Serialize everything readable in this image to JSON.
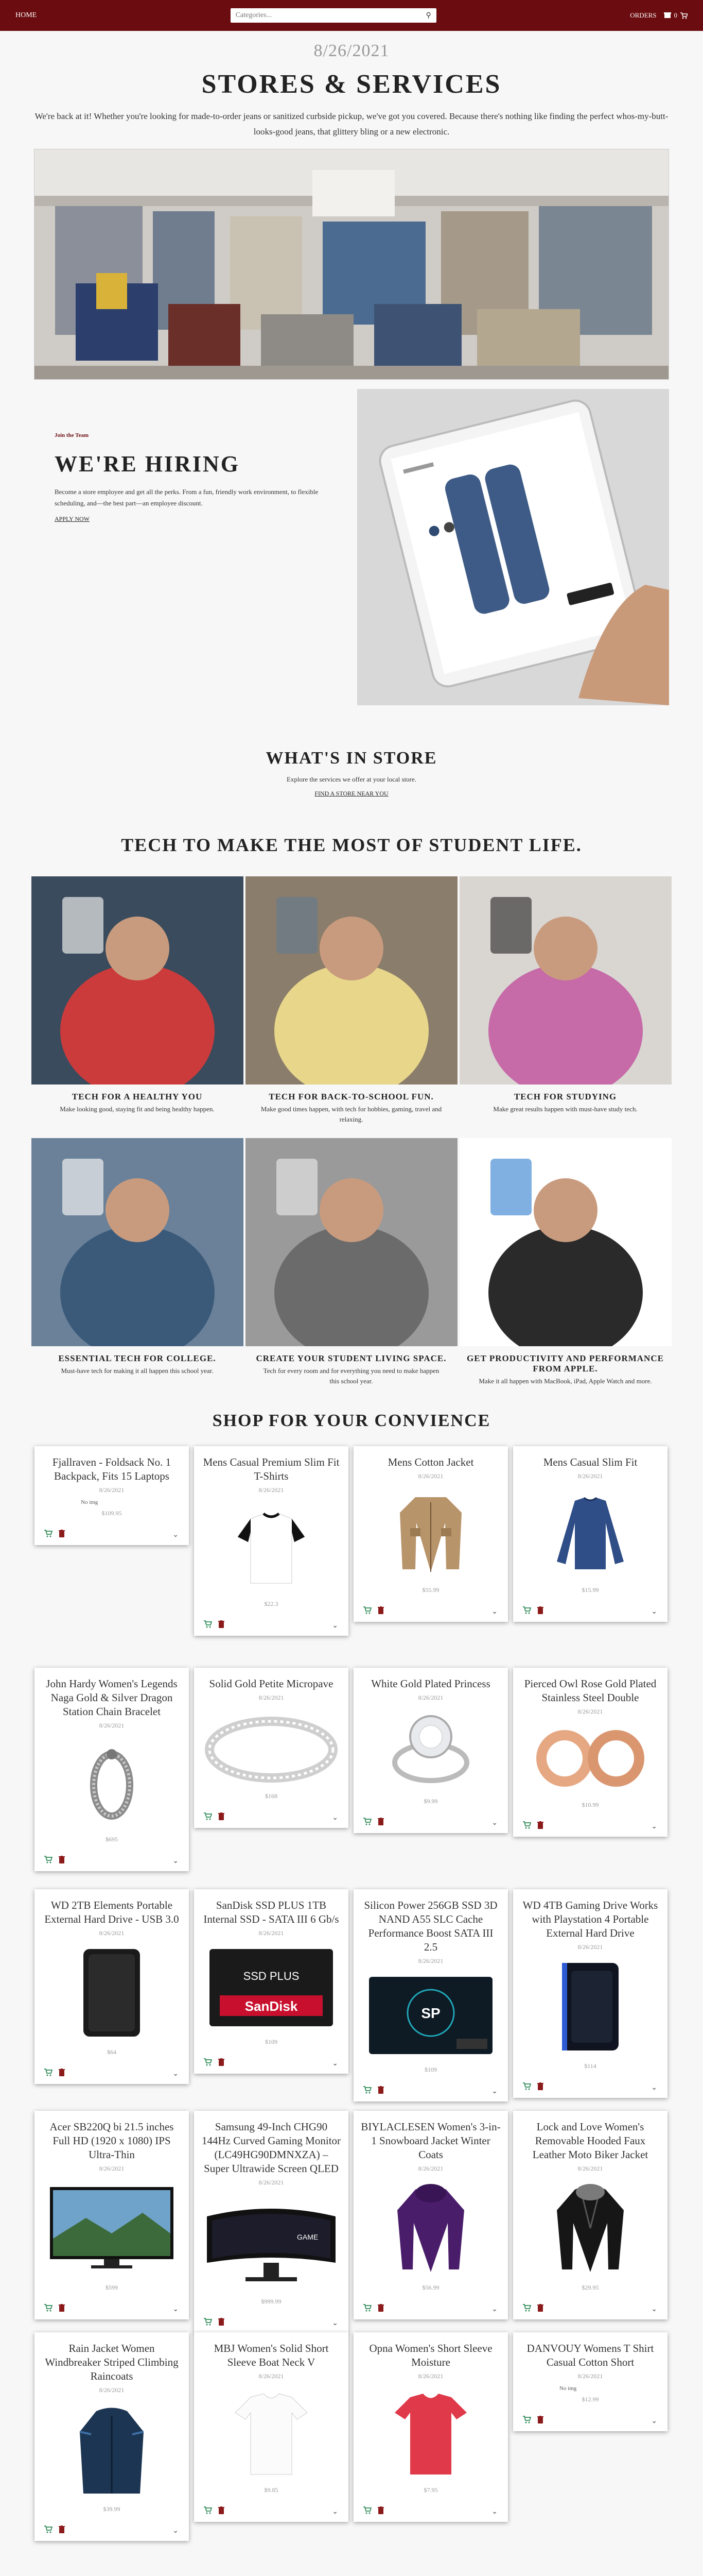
{
  "nav": {
    "home": "HOME",
    "search_placeholder": "Categories...",
    "orders": "ORDERS",
    "cart_count": "0"
  },
  "page": {
    "date": "8/26/2021",
    "title": "STORES & SERVICES",
    "intro": "We're back at it! Whether you're looking for made-to-order jeans or sanitized curbside pickup, we've got you covered. Because there's nothing like finding the perfect whos-my-butt-looks-good jeans, that glittery bling or a new electronic."
  },
  "hiring": {
    "kicker": "Join the Team",
    "title": "WE'RE HIRING",
    "body": "Become a store employee and get all the perks. From a fun, friendly work environment, to flexible scheduling, and—the best part—an employee discount.",
    "link": "APPLY NOW"
  },
  "instore": {
    "title": "WHAT'S IN STORE",
    "body": "Explore the services we offer at your local store.",
    "link": "FIND A STORE NEAR YOU"
  },
  "tech": {
    "title": "TECH TO MAKE THE MOST OF STUDENT LIFE.",
    "cards": [
      {
        "title": "TECH FOR A HEALTHY YOU",
        "body": "Make looking good, staying fit and being healthy happen."
      },
      {
        "title": "TECH FOR BACK-TO-SCHOOL FUN.",
        "body": "Make good times happen, with tech for hobbies, gaming, travel and relaxing."
      },
      {
        "title": "TECH FOR STUDYING",
        "body": "Make great results happen with must-have study tech."
      },
      {
        "title": "ESSENTIAL TECH FOR COLLEGE.",
        "body": "Must-have tech for making it all happen this school year."
      },
      {
        "title": "CREATE YOUR STUDENT LIVING SPACE.",
        "body": "Tech for every room and for everything you need to make happen this school year."
      },
      {
        "title": "GET PRODUCTIVITY AND PERFORMANCE FROM APPLE.",
        "body": "Make it all happen with MacBook, iPad, Apple Watch and more."
      }
    ]
  },
  "shop": {
    "title": "SHOP FOR YOUR CONVIENCE",
    "products": [
      {
        "title": "Fjallraven - Foldsack No. 1 Backpack, Fits 15 Laptops",
        "date": "8/26/2021",
        "price": "$109.95",
        "img": "broken",
        "alt": "No img"
      },
      {
        "title": "Mens Casual Premium Slim Fit T-Shirts",
        "date": "8/26/2021",
        "price": "$22.3",
        "img": "tshirt"
      },
      {
        "title": "Mens Cotton Jacket",
        "date": "8/26/2021",
        "price": "$55.99",
        "img": "jacket"
      },
      {
        "title": "Mens Casual Slim Fit",
        "date": "8/26/2021",
        "price": "$15.99",
        "img": "longsleeve"
      },
      {
        "title": "John Hardy Women's Legends Naga Gold & Silver Dragon Station Chain Bracelet",
        "date": "8/26/2021",
        "price": "$695",
        "img": "bracelet"
      },
      {
        "title": "Solid Gold Petite Micropave",
        "date": "8/26/2021",
        "price": "$168",
        "img": "ring"
      },
      {
        "title": "White Gold Plated Princess",
        "date": "8/26/2021",
        "price": "$9.99",
        "img": "princess"
      },
      {
        "title": "Pierced Owl Rose Gold Plated Stainless Steel Double",
        "date": "8/26/2021",
        "price": "$10.99",
        "img": "rings"
      },
      {
        "title": "WD 2TB Elements Portable External Hard Drive - USB 3.0",
        "date": "8/26/2021",
        "price": "$64",
        "img": "wd"
      },
      {
        "title": "SanDisk SSD PLUS 1TB Internal SSD - SATA III 6 Gb/s",
        "date": "8/26/2021",
        "price": "$109",
        "img": "sandisk"
      },
      {
        "title": "Silicon Power 256GB SSD 3D NAND A55 SLC Cache Performance Boost SATA III 2.5",
        "date": "8/26/2021",
        "price": "$109",
        "img": "sp"
      },
      {
        "title": "WD 4TB Gaming Drive Works with Playstation 4 Portable External Hard Drive",
        "date": "8/26/2021",
        "price": "$114",
        "img": "wd4"
      },
      {
        "title": "Acer SB220Q bi 21.5 inches Full HD (1920 x 1080) IPS Ultra-Thin",
        "date": "8/26/2021",
        "price": "$599",
        "img": "monitor"
      },
      {
        "title": "Samsung 49-Inch CHG90 144Hz Curved Gaming Monitor (LC49HG90DMNXZA) – Super Ultrawide Screen QLED",
        "date": "8/26/2021",
        "price": "$999.99",
        "img": "curved"
      },
      {
        "title": "BIYLACLESEN Women's 3-in-1 Snowboard Jacket Winter Coats",
        "date": "8/26/2021",
        "price": "$56.99",
        "img": "purplejacket"
      },
      {
        "title": "Lock and Love Women's Removable Hooded Faux Leather Moto Biker Jacket",
        "date": "8/26/2021",
        "price": "$29.95",
        "img": "leather"
      },
      {
        "title": "Rain Jacket Women Windbreaker Striped Climbing Raincoats",
        "date": "8/26/2021",
        "price": "$39.99",
        "img": "raincoat"
      },
      {
        "title": "MBJ Women's Solid Short Sleeve Boat Neck V",
        "date": "8/26/2021",
        "price": "$9.85",
        "img": "whitetee"
      },
      {
        "title": "Opna Women's Short Sleeve Moisture",
        "date": "8/26/2021",
        "price": "$7.95",
        "img": "redtee"
      },
      {
        "title": "DANVOUY Womens T Shirt Casual Cotton Short",
        "date": "8/26/2021",
        "price": "$12.99",
        "img": "broken",
        "alt": "No img"
      }
    ]
  },
  "icons": {
    "cart": "cart-icon",
    "trash": "trash-icon",
    "chevron": "chevron-down-icon",
    "search": "search-icon"
  },
  "colors": {
    "brand": "#6b0d10",
    "cart_green": "#2e8b57",
    "trash_red": "#8b1a1a"
  }
}
